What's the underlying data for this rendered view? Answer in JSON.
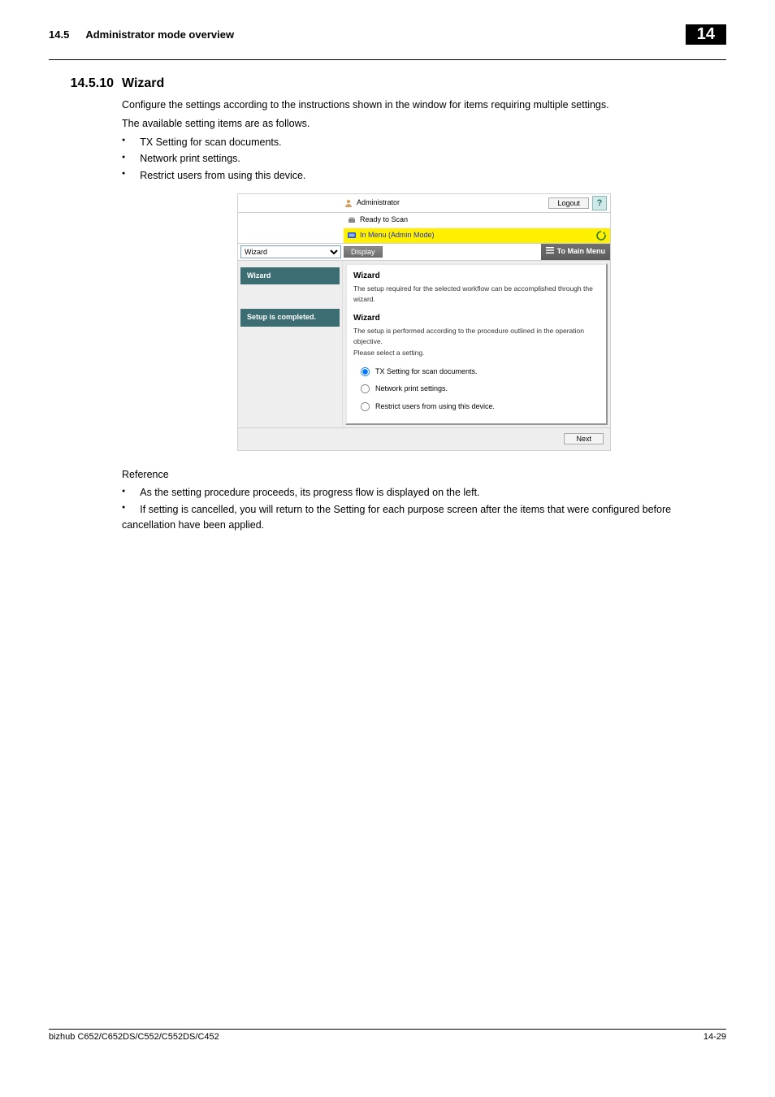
{
  "header": {
    "section_num": "14.5",
    "section_title": "Administrator mode overview",
    "chapter_box": "14"
  },
  "subsection": {
    "num": "14.5.10",
    "title": "Wizard"
  },
  "intro": {
    "p1": "Configure the settings according to the instructions shown in the window for items requiring multiple settings.",
    "p2": "The available setting items are as follows.",
    "bullets": [
      "TX Setting for scan documents.",
      "Network print settings.",
      "Restrict users from using this device."
    ]
  },
  "ui": {
    "topbar": {
      "admin_label": "Administrator",
      "logout": "Logout",
      "help": "?"
    },
    "status": {
      "ready": "Ready to Scan",
      "mode": "In Menu (Admin Mode)"
    },
    "tabrow": {
      "select_value": "Wizard",
      "display": "Display",
      "to_main": "To Main Menu"
    },
    "sidebar": {
      "item1": "Wizard",
      "item2": "Setup is completed."
    },
    "content": {
      "h1": "Wizard",
      "sub1": "The setup required for the selected workflow can be accomplished through the wizard.",
      "h2": "Wizard",
      "sub2a": "The setup is performed according to the procedure outlined in the operation objective.",
      "sub2b": "Please select a setting.",
      "radios": [
        "TX Setting for scan documents.",
        "Network print settings.",
        "Restrict users from using this device."
      ],
      "next": "Next"
    }
  },
  "reference": {
    "heading": "Reference",
    "bullets": [
      "As the setting procedure proceeds, its progress flow is displayed on the left.",
      "If setting is cancelled, you will return to the Setting for each purpose screen after the items that were configured before cancellation have been applied."
    ]
  },
  "footer": {
    "left": "bizhub C652/C652DS/C552/C552DS/C452",
    "right": "14-29"
  }
}
